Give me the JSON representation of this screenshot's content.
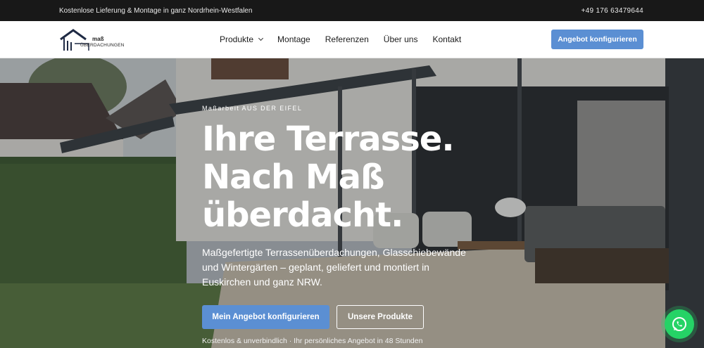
{
  "topbar": {
    "left_text": "Kostenlose Lieferung & Montage in ganz Nordrhein-Westfalen",
    "phone": "+49 176 63479644"
  },
  "logo": {
    "line1": "maß",
    "line2": "ÜBERDACHUNGEN"
  },
  "nav": {
    "items": [
      {
        "label": "Produkte",
        "has_dropdown": true
      },
      {
        "label": "Montage"
      },
      {
        "label": "Referenzen"
      },
      {
        "label": "Über uns"
      },
      {
        "label": "Kontakt"
      }
    ],
    "cta_label": "Angebot konfigurieren"
  },
  "hero": {
    "kicker": "Maßarbeit AUS DER EIFEL",
    "headline_line1": "Ihre Terrasse.",
    "headline_line2": "Nach Maß",
    "headline_line3": "überdacht.",
    "subtitle": "Maßgefertigte Terrassenüberdachungen, Glasschiebewände und Wintergärten – geplant, geliefert und montiert in Euskirchen und ganz NRW.",
    "primary_button": "Mein Angebot konfigurieren",
    "secondary_button": "Unsere Produkte",
    "note": "Kostenlos & unverbindlich · Ihr persönliches Angebot in 48 Stunden"
  },
  "colors": {
    "accent": "#5b8fd3",
    "topbar": "#181818",
    "whatsapp": "#25d366"
  },
  "icons": {
    "logo_mark": "house-roof-icon",
    "dropdown": "chevron-down-icon",
    "chat": "whatsapp-icon"
  }
}
